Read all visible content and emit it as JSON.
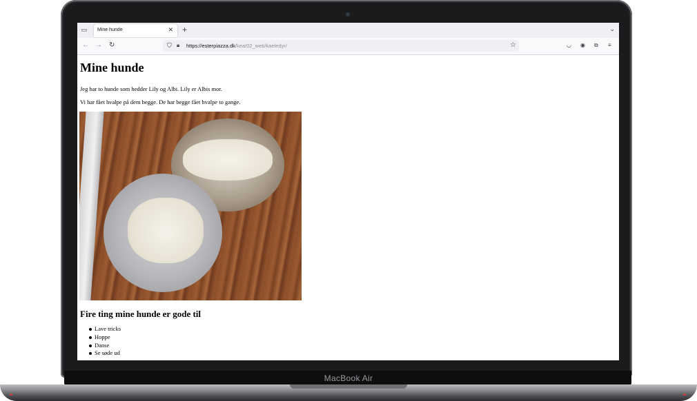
{
  "device": {
    "brand": "MacBook Air"
  },
  "browser": {
    "tab": {
      "title": "Mine hunde"
    },
    "url": {
      "host": "https://esterpiazza.dk",
      "path": "/kea/02_web/kaeledyr/"
    },
    "icons": {
      "tab_list": "tab-list-icon",
      "close": "close-icon",
      "new_tab": "plus-icon",
      "overflow": "chevron-down-icon",
      "back": "arrow-left-icon",
      "forward": "arrow-right-icon",
      "reload": "reload-icon",
      "tracking": "shield-icon",
      "lock": "lock-icon",
      "bookmark": "star-icon",
      "pocket": "pocket-icon",
      "account": "account-icon",
      "extensions": "puzzle-icon",
      "menu": "hamburger-menu-icon"
    }
  },
  "page": {
    "heading": "Mine hunde",
    "paragraph1": "Jeg har to hunde som hedder Lily og Albi. Lily er Albis mor.",
    "paragraph2": "Vi har fået hvalpe på dem begge. De har begge fået hvalpe to gange.",
    "subheading": "Fire ting mine hunde er gode til",
    "things": [
      "Lave tricks",
      "Hoppe",
      "Danse",
      "Se søde ud"
    ]
  }
}
